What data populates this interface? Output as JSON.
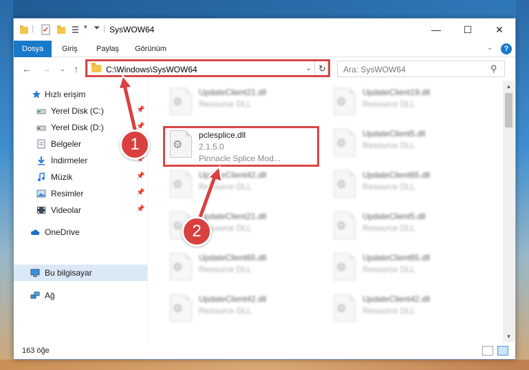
{
  "window": {
    "title": "SysWOW64",
    "minimize": "—",
    "maximize": "☐",
    "close": "✕"
  },
  "ribbon": {
    "tabs": [
      "Dosya",
      "Giriş",
      "Paylaş",
      "Görünüm"
    ],
    "help": "?"
  },
  "address": {
    "path": "C:\\Windows\\SysWOW64",
    "search_placeholder": "Ara: SysWOW64"
  },
  "sidebar": {
    "items": [
      {
        "label": "Hızlı erişim",
        "icon": "star-icon",
        "pinned": false
      },
      {
        "label": "Yerel Disk (C:)",
        "icon": "drive-icon",
        "pinned": true
      },
      {
        "label": "Yerel Disk (D:)",
        "icon": "drive-icon",
        "pinned": true
      },
      {
        "label": "Belgeler",
        "icon": "documents-icon",
        "pinned": true
      },
      {
        "label": "İndirmeler",
        "icon": "downloads-icon",
        "pinned": true
      },
      {
        "label": "Müzik",
        "icon": "music-icon",
        "pinned": true
      },
      {
        "label": "Resimler",
        "icon": "pictures-icon",
        "pinned": true
      },
      {
        "label": "Videolar",
        "icon": "videos-icon",
        "pinned": true
      },
      {
        "label": "OneDrive",
        "icon": "cloud-icon",
        "pinned": false
      },
      {
        "label": "Bu bilgisayar",
        "icon": "computer-icon",
        "pinned": false
      },
      {
        "label": "Ağ",
        "icon": "network-icon",
        "pinned": false
      }
    ]
  },
  "files": [
    {
      "name": "UpdateClient21.dll",
      "type": "Resource DLL",
      "blurred": true
    },
    {
      "name": "UpdateClient19.dll",
      "type": "Resource DLL",
      "blurred": true
    },
    {
      "name": "pclesplice.dll",
      "version": "2.1.5.0",
      "description": "Pinnacle Splice Mod...",
      "blurred": false
    },
    {
      "name": "UpdateClient5.dll",
      "type": "Resource DLL",
      "blurred": true
    },
    {
      "name": "UpdateClient42.dll",
      "type": "Resource DLL",
      "blurred": true
    },
    {
      "name": "UpdateClient65.dll",
      "type": "Resource DLL",
      "blurred": true
    },
    {
      "name": "UpdateClient21.dll",
      "type": "Resource DLL",
      "blurred": true
    },
    {
      "name": "UpdateClient5.dll",
      "type": "Resource DLL",
      "blurred": true
    },
    {
      "name": "UpdateClient65.dll",
      "type": "Resource DLL",
      "blurred": true
    },
    {
      "name": "UpdateClient65.dll",
      "type": "Resource DLL",
      "blurred": true
    },
    {
      "name": "UpdateClient42.dll",
      "type": "Resource DLL",
      "blurred": true
    },
    {
      "name": "UpdateClient42.dll",
      "type": "Resource DLL",
      "blurred": true
    }
  ],
  "status": {
    "count": "163 öğe"
  },
  "callouts": [
    "1",
    "2"
  ],
  "colors": {
    "accent": "#1979ca",
    "highlight": "#d94545"
  }
}
